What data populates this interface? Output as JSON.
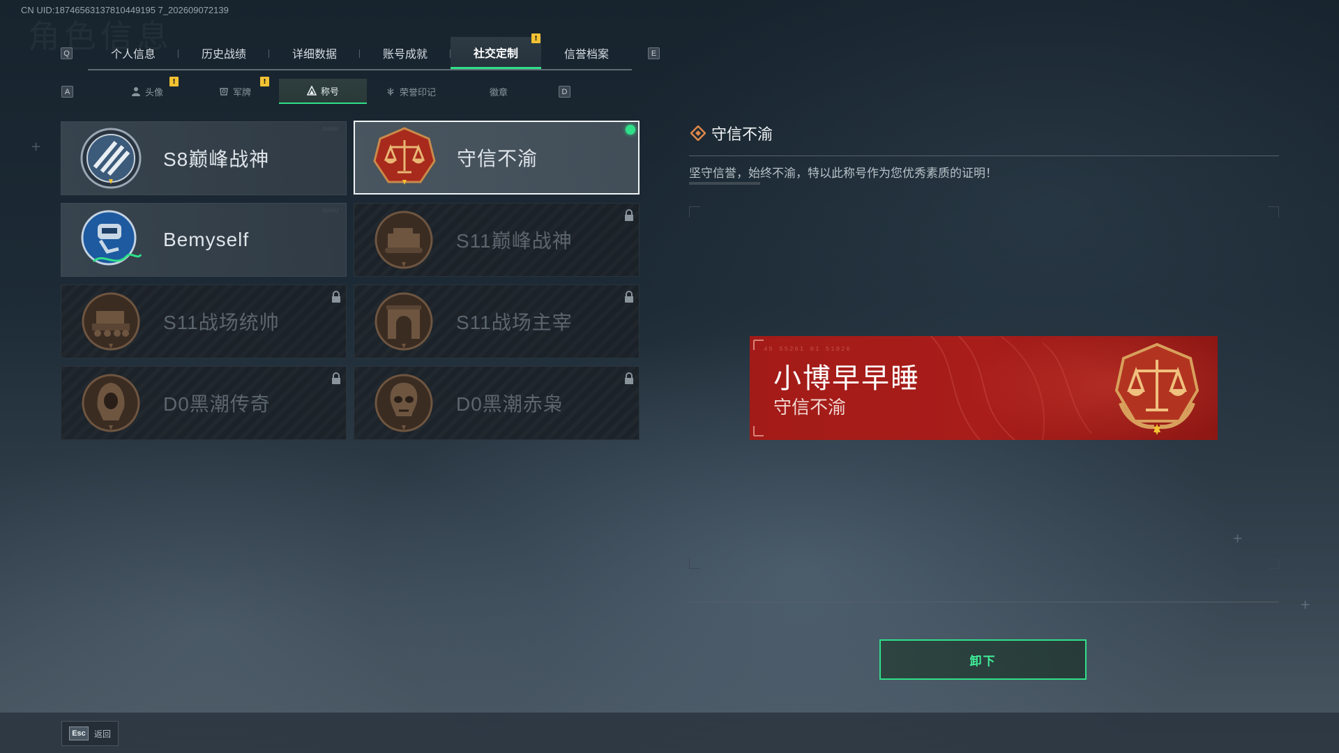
{
  "uid": "CN UID:18746563137810449195 7_202609072139",
  "ghost_title": "角色信息",
  "key_hints": {
    "prev_tab": "Q",
    "next_tab": "E",
    "prev_subtab": "A",
    "next_subtab": "D"
  },
  "tabs": [
    {
      "label": "个人信息",
      "active": false
    },
    {
      "label": "历史战绩",
      "active": false
    },
    {
      "label": "详细数据",
      "active": false
    },
    {
      "label": "账号成就",
      "active": false
    },
    {
      "label": "社交定制",
      "active": true,
      "badge": "!"
    },
    {
      "label": "信誉档案",
      "active": false
    }
  ],
  "subtabs": [
    {
      "label": "头像",
      "icon": "person-icon",
      "badge": "!"
    },
    {
      "label": "军牌",
      "icon": "dogtag-icon",
      "badge": "!"
    },
    {
      "label": "称号",
      "icon": "triangle-icon",
      "active": true
    },
    {
      "label": "荣誉印记",
      "icon": "laurel-icon"
    },
    {
      "label": "徽章",
      "icon": ""
    }
  ],
  "titles": [
    {
      "name": "S8巅峰战神",
      "emblem": "stripes-medal-icon",
      "locked": false,
      "selected": false
    },
    {
      "name": "守信不渝",
      "emblem": "scales-medal-icon",
      "locked": false,
      "selected": true,
      "equipped": true
    },
    {
      "name": "Bemyself",
      "emblem": "robot-signature-icon",
      "locked": false,
      "selected": false
    },
    {
      "name": "S11巅峰战神",
      "emblem": "tank-medal-icon",
      "locked": true
    },
    {
      "name": "S11战场统帅",
      "emblem": "vehicle-medal-icon",
      "locked": true
    },
    {
      "name": "S11战场主宰",
      "emblem": "arch-medal-icon",
      "locked": true
    },
    {
      "name": "D0黑潮传奇",
      "emblem": "hooded-figure-medal-icon",
      "locked": true
    },
    {
      "name": "D0黑潮赤枭",
      "emblem": "skull-medal-icon",
      "locked": true
    }
  ],
  "detail": {
    "title": "守信不渝",
    "description": "坚守信誉，始终不渝，特以此称号作为您优秀素质的证明！"
  },
  "banner": {
    "player_name": "小博早早睡",
    "title": "守信不渝",
    "code": "45 55261 01 51026"
  },
  "unequip_label": "卸下",
  "footer": {
    "esc_key": "Esc",
    "back_label": "返回"
  },
  "colors": {
    "accent": "#2fe089",
    "badge": "#f2c233",
    "banner_red": "#a81d1a"
  }
}
